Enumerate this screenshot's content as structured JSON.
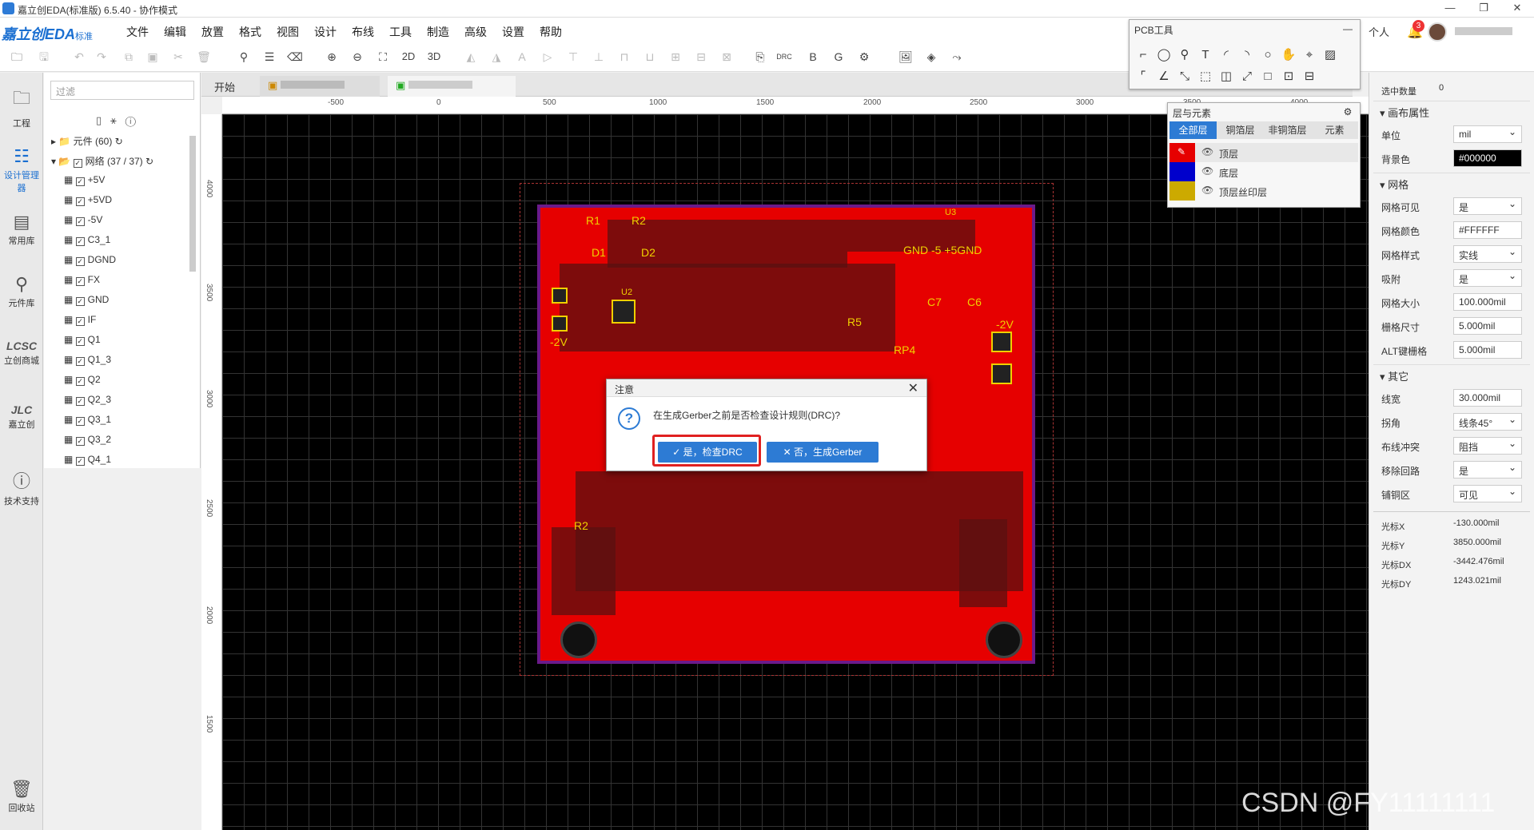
{
  "window": {
    "title": "嘉立创EDA(标准版) 6.5.40 - 协作模式",
    "controls": [
      "—",
      "❐",
      "✕"
    ]
  },
  "brand": {
    "name": "嘉立创EDA",
    "edition": "标准"
  },
  "menu": [
    "文件",
    "编辑",
    "放置",
    "格式",
    "视图",
    "设计",
    "布线",
    "工具",
    "制造",
    "高级",
    "设置",
    "帮助"
  ],
  "user": {
    "label": "个人",
    "notifications": "3"
  },
  "leftbar": [
    {
      "label": "工程",
      "icon": "folder-icon"
    },
    {
      "label": "设计管理器",
      "icon": "design-manager-icon"
    },
    {
      "label": "常用库",
      "icon": "chip-icon"
    },
    {
      "label": "元件库",
      "icon": "search-icon"
    },
    {
      "label": "立创商城",
      "icon": "lcsc-icon"
    },
    {
      "label": "嘉立创",
      "icon": "jlc-icon"
    },
    {
      "label": "技术支持",
      "icon": "help-icon"
    },
    {
      "label": "回收站",
      "icon": "trash-icon"
    }
  ],
  "nav": {
    "filter_placeholder": "过滤",
    "components": "元件 (60)",
    "nets_title": "网络 (37 / 37)",
    "nets": [
      "+5V",
      "+5VD",
      "-5V",
      "C3_1",
      "DGND",
      "FX",
      "GND",
      "IF",
      "Q1",
      "Q1_3",
      "Q2",
      "Q2_3",
      "Q3_1",
      "Q3_2",
      "Q4_1"
    ]
  },
  "tabs": {
    "start": "开始"
  },
  "rulers": {
    "h": [
      "-500",
      "0",
      "500",
      "1000",
      "1500",
      "2000",
      "2500",
      "3000",
      "3500",
      "4000"
    ],
    "v": [
      "4000",
      "3500",
      "3000",
      "2500",
      "2000",
      "1500"
    ]
  },
  "pcb_tools": {
    "title": "PCB工具"
  },
  "layers_panel": {
    "title": "层与元素",
    "tabs": [
      "全部层",
      "铜箔层",
      "非铜箔层",
      "元素"
    ],
    "layers": [
      {
        "name": "顶层",
        "color": "#e60000"
      },
      {
        "name": "底层",
        "color": "#0000cc"
      },
      {
        "name": "顶层丝印层",
        "color": "#ccaa00"
      }
    ]
  },
  "board_labels": {
    "r1": "R1",
    "r2": "R2",
    "d1": "D1",
    "d2": "D2",
    "neg2v_left": "-2V",
    "neg2v_right": "-2V",
    "gnd_pins": "GND -5 +5GND",
    "c7": "C7",
    "c6": "C6",
    "r5": "R5",
    "rp4": "RP4",
    "r2b": "R2",
    "u2": "U2",
    "u3": "U3"
  },
  "dialog": {
    "title": "注意",
    "message": "在生成Gerber之前是否检查设计规则(DRC)?",
    "yes_label": "✓ 是，检查DRC",
    "no_label": "✕ 否，生成Gerber"
  },
  "properties": {
    "selected_count_label": "选中数量",
    "selected_count": "0",
    "canvas_title": "画布属性",
    "unit_label": "单位",
    "unit": "mil",
    "bg_label": "背景色",
    "bg": "#000000",
    "grid_title": "网格",
    "grid_visible_label": "网格可见",
    "grid_visible": "是",
    "grid_color_label": "网格颜色",
    "grid_color": "#FFFFFF",
    "grid_style_label": "网格样式",
    "grid_style": "实线",
    "snap_label": "吸附",
    "snap": "是",
    "grid_size_label": "网格大小",
    "grid_size": "100.000mil",
    "snap_size_label": "栅格尺寸",
    "snap_size": "5.000mil",
    "alt_snap_label": "ALT键栅格",
    "alt_snap": "5.000mil",
    "other_title": "其它",
    "line_width_label": "线宽",
    "line_width": "30.000mil",
    "corner_label": "拐角",
    "corner": "线条45°",
    "conflict_label": "布线冲突",
    "conflict": "阻挡",
    "remove_loop_label": "移除回路",
    "remove_loop": "是",
    "pour_label": "铺铜区",
    "pour": "可见",
    "cursor_x_label": "光标X",
    "cursor_x": "-130.000mil",
    "cursor_y_label": "光标Y",
    "cursor_y": "3850.000mil",
    "cursor_dx_label": "光标DX",
    "cursor_dx": "-3442.476mil",
    "cursor_dy_label": "光标DY",
    "cursor_dy": "1243.021mil"
  },
  "watermark": "CSDN @FY11111111"
}
